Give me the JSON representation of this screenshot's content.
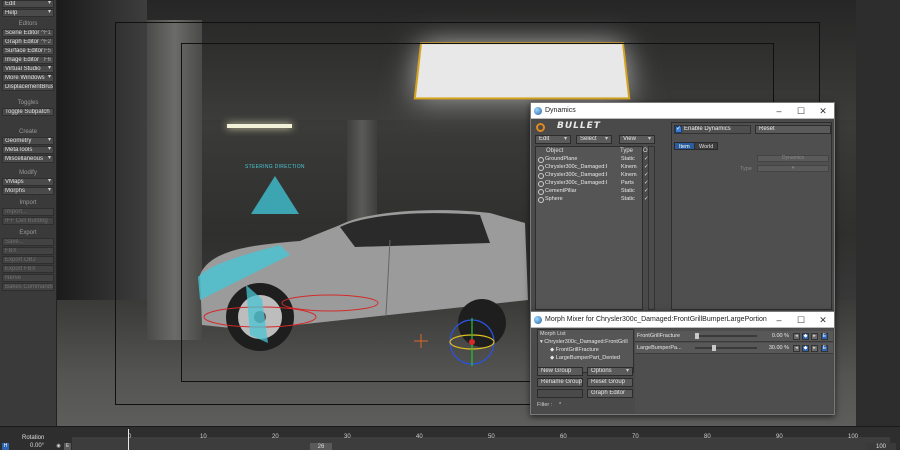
{
  "toolbar": {
    "top": [
      {
        "label": "Edit"
      },
      {
        "label": "Help"
      }
    ],
    "editors_head": "Editors",
    "editors": [
      {
        "label": "Scene Editor",
        "hint": "^F1"
      },
      {
        "label": "Graph Editor",
        "hint": "^F2"
      },
      {
        "label": "Surface Editor",
        "hint": "F5"
      },
      {
        "label": "Image Editor",
        "hint": "F6"
      },
      {
        "label": "Virtual Studio",
        "hint": ""
      },
      {
        "label": "More Windows",
        "hint": ""
      },
      {
        "label": "DisplacementBrush...",
        "hint": ""
      }
    ],
    "toggles_head": "Toggles",
    "toggles": [
      {
        "label": "Toggle Subpatch"
      }
    ],
    "create_head": "Create",
    "create": [
      {
        "label": "Geometry"
      },
      {
        "label": "MetaTools"
      },
      {
        "label": "Miscellaneous"
      }
    ],
    "modify_head": "Modify",
    "modify": [
      {
        "label": "VMaps"
      },
      {
        "label": "Morphs"
      }
    ],
    "import_head": "Import",
    "import_items": [
      {
        "label": "Import..."
      },
      {
        "label": "IFF Cell Bulldog"
      }
    ],
    "export_head": "Export",
    "export_items": [
      {
        "label": "Save..."
      },
      {
        "label": "FBX"
      },
      {
        "label": "Export OBJ"
      },
      {
        "label": "Export FBX"
      },
      {
        "label": "Nerve"
      },
      {
        "label": "Bakes Commands"
      }
    ]
  },
  "viewport": {
    "steering_label": "STEERING DIRECTION",
    "accent_cyan": "#49c6d4",
    "light_border": "#d6a31f"
  },
  "dynamics": {
    "title": "Dynamics",
    "logo": "BULLET",
    "menus": [
      {
        "label": "Edit"
      },
      {
        "label": "Select"
      },
      {
        "label": "View"
      }
    ],
    "columns": {
      "object": "Object",
      "type": "Type",
      "on": "On"
    },
    "rows": [
      {
        "object": "GroundPlane",
        "type": "Static",
        "on": "✓"
      },
      {
        "object": "Chrysler300c_Damaged:Fro",
        "type": "Kinematic",
        "on": "✓"
      },
      {
        "object": "Chrysler300c_Damaged:Fro",
        "type": "Kinematic",
        "on": "✓"
      },
      {
        "object": "Chrysler300c_Damaged:He",
        "type": "Parts",
        "on": "✓"
      },
      {
        "object": "CementPillar",
        "type": "Static",
        "on": "✓"
      },
      {
        "object": "Sphere",
        "type": "Static",
        "on": "✓"
      }
    ],
    "enable_label": "Enable Dynamics",
    "enable_checked": "✓",
    "reset_label": "Reset",
    "tabs": [
      {
        "label": "Item"
      },
      {
        "label": "World"
      }
    ],
    "type_label": "Type",
    "field_value": "Dynamics"
  },
  "morph": {
    "title": "Morph Mixer for Chrysler300c_Damaged:FrontGrillBumperLargePortion",
    "list_header": "Morph List",
    "list_items": [
      {
        "label": "▾ Chrysler300c_Damaged:FrontGrill"
      },
      {
        "label": "◆ FrontGrillFracture"
      },
      {
        "label": "◆ LargeBumperPart_Dented"
      }
    ],
    "sliders": [
      {
        "label": "FrontGrillFracture",
        "value": "0.00 %",
        "fraction": 0
      },
      {
        "label": "LargeBumperPa...",
        "value": "30.00 %",
        "fraction": 0.3
      }
    ],
    "buttons": {
      "new_group": "New Group",
      "options": "Options",
      "rename_group": "Rename Group",
      "reset_group": "Reset Group",
      "graph_editor": "Graph Editor"
    },
    "filter_label": "Filter :",
    "filter_value": "*"
  },
  "timeline": {
    "channel_label": "Rotation",
    "channel_value": "0.00°",
    "ticks": [
      "0",
      "10",
      "20",
      "30",
      "40",
      "50",
      "60",
      "70",
      "80",
      "90",
      "100"
    ],
    "current_frame": "26",
    "end_frame": "100"
  }
}
